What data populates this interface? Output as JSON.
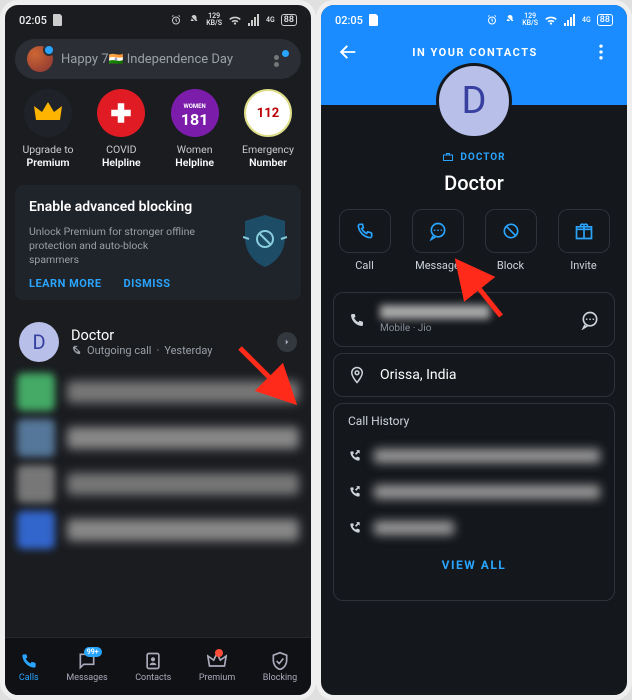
{
  "left": {
    "status": {
      "time": "02:05",
      "speed_num": "129",
      "speed_unit": "KB/S",
      "battery": "88"
    },
    "search": {
      "text": "Happy 7",
      "text_suffix": " Independence Day"
    },
    "shortcuts": [
      {
        "line1": "Upgrade to",
        "line2": "Premium"
      },
      {
        "line1": "COVID",
        "line2": "Helpline"
      },
      {
        "line1": "Women",
        "line2": "Helpline",
        "badge": "181"
      },
      {
        "line1": "Emergency",
        "line2": "Number",
        "badge": "112"
      }
    ],
    "promo": {
      "title": "Enable advanced blocking",
      "body": "Unlock Premium for stronger offline protection and auto-block spammers",
      "learn": "LEARN MORE",
      "dismiss": "DISMISS"
    },
    "call": {
      "initial": "D",
      "name": "Doctor",
      "type": "Outgoing call",
      "when": "Yesterday"
    },
    "nav": {
      "calls": "Calls",
      "messages": "Messages",
      "contacts": "Contacts",
      "premium": "Premium",
      "blocking": "Blocking",
      "msg_badge": "99+"
    }
  },
  "right": {
    "status": {
      "time": "02:05",
      "speed_num": "129",
      "speed_unit": "KB/S",
      "battery": "88"
    },
    "header": "IN YOUR CONTACTS",
    "avatar_initial": "D",
    "tag": "DOCTOR",
    "name": "Doctor",
    "actions": {
      "call": "Call",
      "message": "Message",
      "block": "Block",
      "invite": "Invite"
    },
    "phone_sub": "Mobile · Jio",
    "location": "Orissa, India",
    "history_title": "Call History",
    "view_all": "VIEW ALL"
  }
}
